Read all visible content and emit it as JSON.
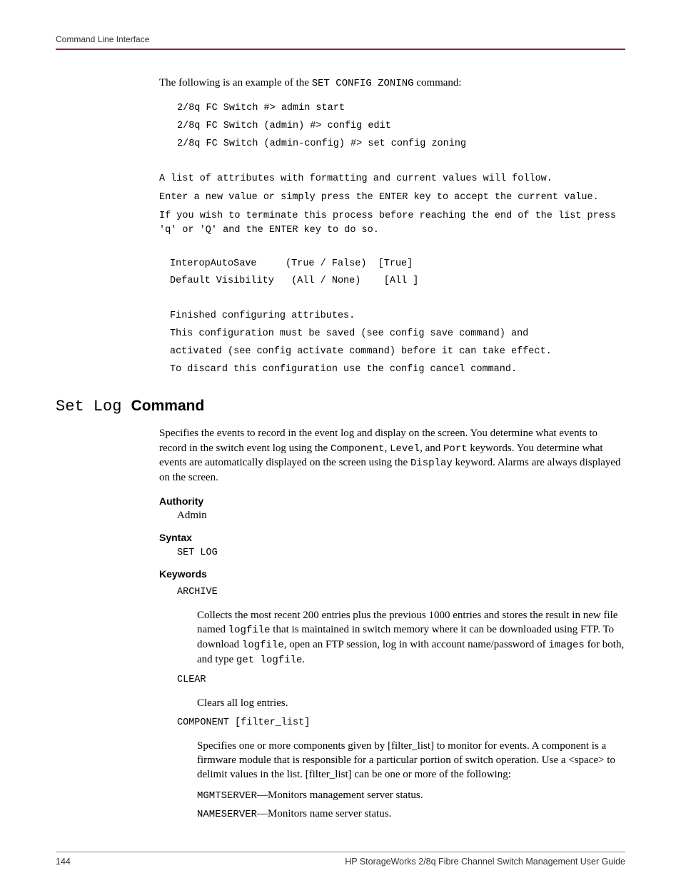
{
  "header": {
    "section": "Command Line Interface"
  },
  "intro": {
    "prefix": "The following is an example of the ",
    "cmd": "SET CONFIG ZONING",
    "suffix": " command:"
  },
  "term": {
    "l1": "2/8q FC Switch #> admin start",
    "l2": "2/8q FC Switch (admin) #> config edit",
    "l3": "2/8q FC Switch (admin-config) #> set config zoning",
    "p1": "A list of attributes with formatting and current values will follow.",
    "p2": "Enter a new value or simply press the ENTER key to accept the current value.",
    "p3": "If you wish to terminate this process before reaching the end of the list press 'q' or 'Q' and the ENTER key to do so.",
    "attr1": "InteropAutoSave     (True / False)  [True]",
    "attr2": "Default Visibility   (All / None)    [All ]",
    "f1": "Finished configuring attributes.",
    "f2": "This configuration must be saved (see config save command) and",
    "f3": "activated (see config activate command) before it can take effect.",
    "f4": "To discard this configuration use the config cancel command."
  },
  "section": {
    "cmd": "Set Log ",
    "title": "Command"
  },
  "desc": {
    "t1": "Specifies the events to record in the event log and display on the screen. You determine what events to record in the switch event log using the ",
    "c1": "Component",
    "t2": ", ",
    "c2": "Level",
    "t3": ", and ",
    "c3": "Port",
    "t4": " keywords. You determine what events are automatically displayed on the screen using the ",
    "c4": "Display",
    "t5": " keyword. Alarms are always displayed on the screen."
  },
  "authority": {
    "heading": "Authority",
    "value": "Admin"
  },
  "syntax": {
    "heading": "Syntax",
    "value": "SET LOG"
  },
  "keywords": {
    "heading": "Keywords",
    "archive": {
      "name": "ARCHIVE",
      "d1": "Collects the most recent 200 entries plus the previous 1000 entries and stores the result in new file named ",
      "c1": "logfile",
      "d2": " that is maintained in switch memory where it can be downloaded using FTP. To download ",
      "c2": "logfile",
      "d3": ", open an FTP session, log in with account name/password of ",
      "c3": "images",
      "d4": " for both, and type ",
      "c4": "get logfile",
      "d5": "."
    },
    "clear": {
      "name": "CLEAR",
      "desc": "Clears all log entries."
    },
    "component": {
      "name": "COMPONENT [filter_list]",
      "desc": "Specifies one or more components given by [filter_list] to monitor for events. A component is a firmware module that is responsible for a particular portion of switch operation. Use a <space> to delimit values in the list. [filter_list] can be one or more of the following:",
      "mgmt_code": "MGMTSERVER",
      "mgmt_text": "—Monitors management server status.",
      "name_code": "NAMESERVER",
      "name_text": "—Monitors name server status."
    }
  },
  "footer": {
    "page": "144",
    "guide": "HP StorageWorks 2/8q Fibre Channel Switch Management User Guide"
  }
}
